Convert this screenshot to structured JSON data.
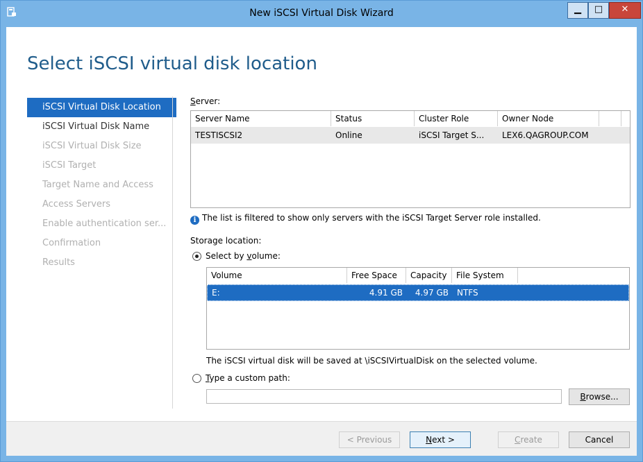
{
  "window": {
    "title": "New iSCSI Virtual Disk Wizard",
    "app_icon": "server-manager-icon"
  },
  "heading": "Select iSCSI virtual disk location",
  "nav": {
    "items": [
      {
        "label": "iSCSI Virtual Disk Location",
        "state": "active"
      },
      {
        "label": "iSCSI Virtual Disk Name",
        "state": "enabled"
      },
      {
        "label": "iSCSI Virtual Disk Size",
        "state": "disabled"
      },
      {
        "label": "iSCSI Target",
        "state": "disabled"
      },
      {
        "label": "Target Name and Access",
        "state": "disabled"
      },
      {
        "label": "Access Servers",
        "state": "disabled"
      },
      {
        "label": "Enable authentication ser...",
        "state": "disabled"
      },
      {
        "label": "Confirmation",
        "state": "disabled"
      },
      {
        "label": "Results",
        "state": "disabled"
      }
    ]
  },
  "server": {
    "label_first": "S",
    "label_rest": "erver:",
    "columns": [
      "Server Name",
      "Status",
      "Cluster Role",
      "Owner Node"
    ],
    "rows": [
      [
        "TESTISCSI2",
        "Online",
        "iSCSI Target S...",
        "LEX6.QAGROUP.COM"
      ]
    ],
    "info": "The list is filtered to show only servers with the iSCSI Target Server role installed."
  },
  "storage": {
    "label": "Storage location:",
    "by_volume_pre": "Select by ",
    "by_volume_u": "v",
    "by_volume_post": "olume:",
    "volume_columns": [
      "Volume",
      "Free Space",
      "Capacity",
      "File System"
    ],
    "volume_rows": [
      [
        "E:",
        "4.91 GB",
        "4.97 GB",
        "NTFS"
      ]
    ],
    "save_note": "The iSCSI virtual disk will be saved at \\iSCSIVirtualDisk on the selected volume.",
    "custom_u": "T",
    "custom_rest": "ype a custom path:",
    "custom_path_value": "",
    "browse_u": "B",
    "browse_rest": "rowse..."
  },
  "footer": {
    "previous": "< Previous",
    "next_u": "N",
    "next_rest": "ext >",
    "create_u": "C",
    "create_rest": "reate",
    "cancel": "Cancel"
  },
  "colors": {
    "title_bar": "#79b4e6",
    "heading": "#1f5c8b",
    "selection": "#1e6cc2"
  }
}
